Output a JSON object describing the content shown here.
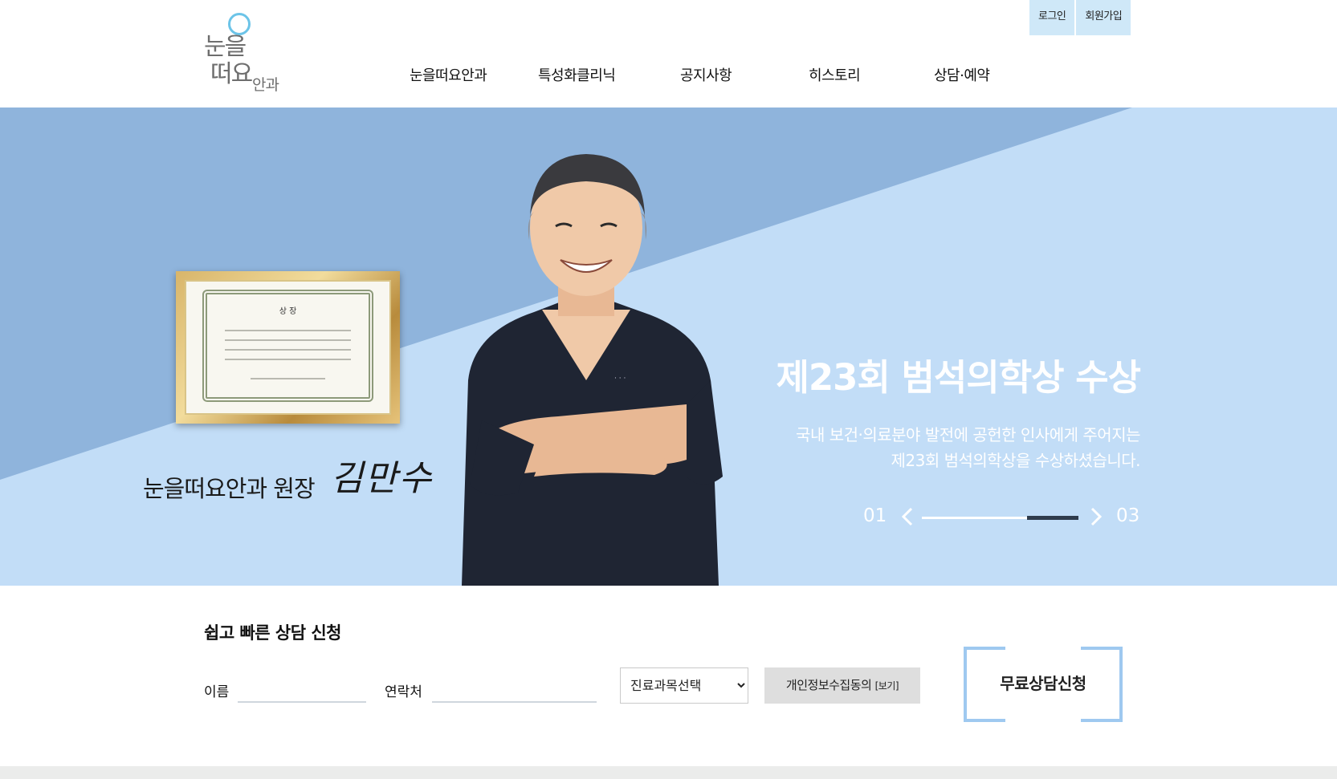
{
  "brand": {
    "logo_line1": "눈을",
    "logo_line2": "떠요",
    "logo_line3": "안과",
    "accent": "#6cc4e8"
  },
  "utility": {
    "login": "로그인",
    "signup": "회원가입"
  },
  "nav": [
    {
      "label": "눈을떠요안과"
    },
    {
      "label": "특성화클리닉"
    },
    {
      "label": "공지사항"
    },
    {
      "label": "히스토리"
    },
    {
      "label": "상담·예약"
    }
  ],
  "hero": {
    "certificate_title": "상   장",
    "director_label": "눈을떠요안과 원장",
    "director_signature": "김만수",
    "headline": "제23회 범석의학상 수상",
    "description_line1": "국내 보건·의료분야 발전에 공헌한 인사에게 주어지는",
    "description_line2": "제23회 범석의학상을 수상하셨습니다.",
    "slider": {
      "current": "01",
      "total": "03",
      "progress_start": 0.67,
      "progress_end": 1.0
    },
    "colors": {
      "light": "#c2ddf7",
      "dark": "#8fb4dc",
      "scrubs": "#1f2533"
    }
  },
  "consult": {
    "title": "쉽고 빠른 상담 신청",
    "name_label": "이름",
    "name_value": "",
    "phone_label": "연락처",
    "phone_value": "",
    "department_selected": "진료과목선택",
    "privacy_label": "개인정보수집동의",
    "privacy_view": "[보기]",
    "submit_label": "무료상담신청"
  }
}
